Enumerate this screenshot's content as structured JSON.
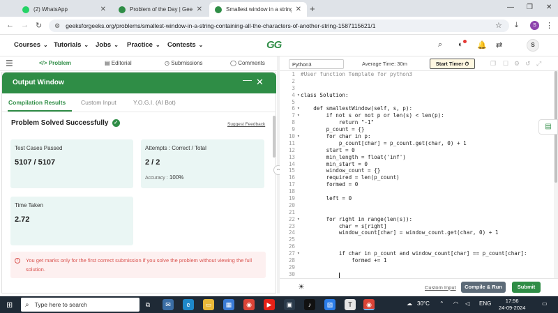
{
  "browser": {
    "tabs": [
      {
        "title": "(2) WhatsApp",
        "icon": "whatsapp-icon",
        "color": "#25d366"
      },
      {
        "title": "Problem of the Day | GeeksforG",
        "icon": "gfg-icon",
        "color": "#2f8d46"
      },
      {
        "title": "Smallest window in a string con",
        "icon": "gfg-icon",
        "color": "#2f8d46"
      }
    ],
    "new_tab": "+",
    "url": "geeksforgeeks.org/problems/smallest-window-in-a-string-containing-all-the-characters-of-another-string-1587115621/1",
    "profile_initial": "S"
  },
  "gfg_nav": {
    "menus": [
      "Courses",
      "Tutorials",
      "Jobs",
      "Practice",
      "Contests"
    ],
    "logo": "GG",
    "user_initial": "S"
  },
  "problem_tabs": [
    "Problem",
    "Editorial",
    "Submissions",
    "Comments"
  ],
  "output_window": {
    "title": "Output Window",
    "tabs": [
      "Compilation Results",
      "Custom Input",
      "Y.O.G.I. (AI Bot)"
    ],
    "status": "Problem Solved Successfully",
    "suggest_feedback": "Suggest Feedback",
    "cards": {
      "test_cases": {
        "label": "Test Cases Passed",
        "value": "5107 / 5107"
      },
      "attempts": {
        "label": "Attempts : Correct / Total",
        "value": "2 / 2",
        "accuracy_label": "Accuracy :",
        "accuracy_value": "100%"
      },
      "time": {
        "label": "Time Taken",
        "value": "2.72"
      }
    },
    "notice": "You get marks only for the first correct submission if you solve the problem without viewing the full solution."
  },
  "editor": {
    "language": "Python3",
    "average_time": "Average Time: 30m",
    "timer_button": "Start Timer ⏱",
    "lines": [
      "#User function Template for python3",
      "",
      "",
      "class Solution:",
      "",
      "    def smallestWindow(self, s, p):",
      "        if not s or not p or len(s) < len(p):",
      "            return \"-1\"",
      "        p_count = {}",
      "        for char in p:",
      "            p_count[char] = p_count.get(char, 0) + 1",
      "        start = 0",
      "        min_length = float('inf')",
      "        min_start = 0",
      "        window_count = {}",
      "        required = len(p_count)",
      "        formed = 0",
      "",
      "        left = 0",
      "",
      "",
      "        for right in range(len(s)):",
      "            char = s[right]",
      "            window_count[char] = window_count.get(char, 0) + 1",
      "",
      "",
      "            if char in p_count and window_count[char] == p_count[char]:",
      "                formed += 1",
      "",
      ""
    ],
    "line_numbers": [
      "1",
      "2",
      "3",
      "4",
      "5",
      "6",
      "7",
      "8",
      "9",
      "10",
      "11",
      "12",
      "13",
      "14",
      "15",
      "16",
      "17",
      "18",
      "19",
      "20",
      "21",
      "22",
      "23",
      "24",
      "25",
      "26",
      "27",
      "28",
      "29",
      "30"
    ],
    "fold_lines": [
      4,
      6,
      7,
      10,
      22,
      27
    ]
  },
  "actions": {
    "custom_input": "Custom Input",
    "compile": "Compile & Run",
    "submit": "Submit"
  },
  "taskbar": {
    "search_placeholder": "Type here to search",
    "weather": "30°C",
    "lang": "ENG",
    "time": "17:56",
    "date": "24-09-2024"
  }
}
